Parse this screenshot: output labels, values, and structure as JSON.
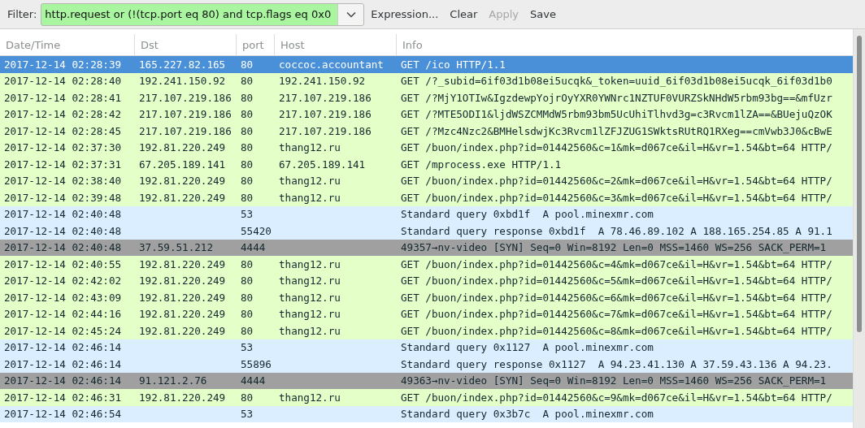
{
  "filter": {
    "label": "Filter:",
    "value": "http.request or (!(tcp.port eq 80) and tcp.flags eq 0x0",
    "buttons": [
      {
        "label": "Expression...",
        "disabled": false
      },
      {
        "label": "Clear",
        "disabled": false
      },
      {
        "label": "Apply",
        "disabled": true
      },
      {
        "label": "Save",
        "disabled": false
      }
    ]
  },
  "table": {
    "columns": [
      "Date/Time",
      "Dst",
      "port",
      "Host",
      "Info"
    ],
    "rows": [
      {
        "date": "2017-12-14 02:28:39",
        "dst": "165.227.82.165",
        "port": "80",
        "host": "coccoc.accountant",
        "info": "GET /ico HTTP/1.1",
        "kind": "http",
        "selected": true
      },
      {
        "date": "2017-12-14 02:28:40",
        "dst": "192.241.150.92",
        "port": "80",
        "host": "192.241.150.92",
        "info": "GET /?_subid=6if03d1b08ei5ucqk&_token=uuid_6if03d1b08ei5ucqk_6if03d1b0",
        "kind": "http",
        "selected": false
      },
      {
        "date": "2017-12-14 02:28:41",
        "dst": "217.107.219.186",
        "port": "80",
        "host": "217.107.219.186",
        "info": "GET /?MjY1OTIw&IgzdewpYojrOyYXR0YWNrc1NZTUF0VURZSkNHdW5rbm93bg==&mfUzr",
        "kind": "http",
        "selected": false
      },
      {
        "date": "2017-12-14 02:28:42",
        "dst": "217.107.219.186",
        "port": "80",
        "host": "217.107.219.186",
        "info": "GET /?MTE5ODI1&ljdWSZCMMdW5rbm93bm5UcUhiTlhvd3g=c3Rvcm1lZA==&BUejuQzOK",
        "kind": "http",
        "selected": false
      },
      {
        "date": "2017-12-14 02:28:45",
        "dst": "217.107.219.186",
        "port": "80",
        "host": "217.107.219.186",
        "info": "GET /?Mzc4Nzc2&BMHelsdwjKc3Rvcm1lZFJZUG1SWktsRUtRQ1RXeg==cmVwb3J0&cBwE",
        "kind": "http",
        "selected": false
      },
      {
        "date": "2017-12-14 02:37:30",
        "dst": "192.81.220.249",
        "port": "80",
        "host": "thang12.ru",
        "info": "GET /buon/index.php?id=01442560&c=1&mk=d067ce&il=H&vr=1.54&bt=64 HTTP/",
        "kind": "http",
        "selected": false
      },
      {
        "date": "2017-12-14 02:37:31",
        "dst": "67.205.189.141",
        "port": "80",
        "host": "67.205.189.141",
        "info": "GET /mprocess.exe HTTP/1.1",
        "kind": "http",
        "selected": false
      },
      {
        "date": "2017-12-14 02:38:40",
        "dst": "192.81.220.249",
        "port": "80",
        "host": "thang12.ru",
        "info": "GET /buon/index.php?id=01442560&c=2&mk=d067ce&il=H&vr=1.54&bt=64 HTTP/",
        "kind": "http",
        "selected": false
      },
      {
        "date": "2017-12-14 02:39:48",
        "dst": "192.81.220.249",
        "port": "80",
        "host": "thang12.ru",
        "info": "GET /buon/index.php?id=01442560&c=3&mk=d067ce&il=H&vr=1.54&bt=64 HTTP/",
        "kind": "http",
        "selected": false
      },
      {
        "date": "2017-12-14 02:40:48",
        "port": "53",
        "info": "Standard query 0xbd1f  A pool.minexmr.com",
        "kind": "dns",
        "selected": false
      },
      {
        "date": "2017-12-14 02:40:48",
        "port": "55420",
        "info": "Standard query response 0xbd1f  A 78.46.89.102 A 188.165.254.85 A 91.1",
        "kind": "dns",
        "selected": false
      },
      {
        "date": "2017-12-14 02:40:48",
        "dst": "37.59.51.212",
        "port": "4444",
        "info": "49357→nv-video [SYN] Seq=0 Win=8192 Len=0 MSS=1460 WS=256 SACK_PERM=1",
        "kind": "syn",
        "selected": false
      },
      {
        "date": "2017-12-14 02:40:55",
        "dst": "192.81.220.249",
        "port": "80",
        "host": "thang12.ru",
        "info": "GET /buon/index.php?id=01442560&c=4&mk=d067ce&il=H&vr=1.54&bt=64 HTTP/",
        "kind": "http",
        "selected": false
      },
      {
        "date": "2017-12-14 02:42:02",
        "dst": "192.81.220.249",
        "port": "80",
        "host": "thang12.ru",
        "info": "GET /buon/index.php?id=01442560&c=5&mk=d067ce&il=H&vr=1.54&bt=64 HTTP/",
        "kind": "http",
        "selected": false
      },
      {
        "date": "2017-12-14 02:43:09",
        "dst": "192.81.220.249",
        "port": "80",
        "host": "thang12.ru",
        "info": "GET /buon/index.php?id=01442560&c=6&mk=d067ce&il=H&vr=1.54&bt=64 HTTP/",
        "kind": "http",
        "selected": false
      },
      {
        "date": "2017-12-14 02:44:16",
        "dst": "192.81.220.249",
        "port": "80",
        "host": "thang12.ru",
        "info": "GET /buon/index.php?id=01442560&c=7&mk=d067ce&il=H&vr=1.54&bt=64 HTTP/",
        "kind": "http",
        "selected": false
      },
      {
        "date": "2017-12-14 02:45:24",
        "dst": "192.81.220.249",
        "port": "80",
        "host": "thang12.ru",
        "info": "GET /buon/index.php?id=01442560&c=8&mk=d067ce&il=H&vr=1.54&bt=64 HTTP/",
        "kind": "http",
        "selected": false
      },
      {
        "date": "2017-12-14 02:46:14",
        "port": "53",
        "info": "Standard query 0x1127  A pool.minexmr.com",
        "kind": "dns",
        "selected": false
      },
      {
        "date": "2017-12-14 02:46:14",
        "port": "55896",
        "info": "Standard query response 0x1127  A 94.23.41.130 A 37.59.43.136 A 94.23.",
        "kind": "dns",
        "selected": false
      },
      {
        "date": "2017-12-14 02:46:14",
        "dst": "91.121.2.76",
        "port": "4444",
        "info": "49363→nv-video [SYN] Seq=0 Win=8192 Len=0 MSS=1460 WS=256 SACK_PERM=1",
        "kind": "syn",
        "selected": false
      },
      {
        "date": "2017-12-14 02:46:31",
        "dst": "192.81.220.249",
        "port": "80",
        "host": "thang12.ru",
        "info": "GET /buon/index.php?id=01442560&c=9&mk=d067ce&il=H&vr=1.54&bt=64 HTTP/",
        "kind": "http",
        "selected": false
      },
      {
        "date": "2017-12-14 02:46:54",
        "port": "53",
        "info": "Standard query 0x3b7c  A pool.minexmr.com",
        "kind": "dns",
        "selected": false
      }
    ]
  }
}
